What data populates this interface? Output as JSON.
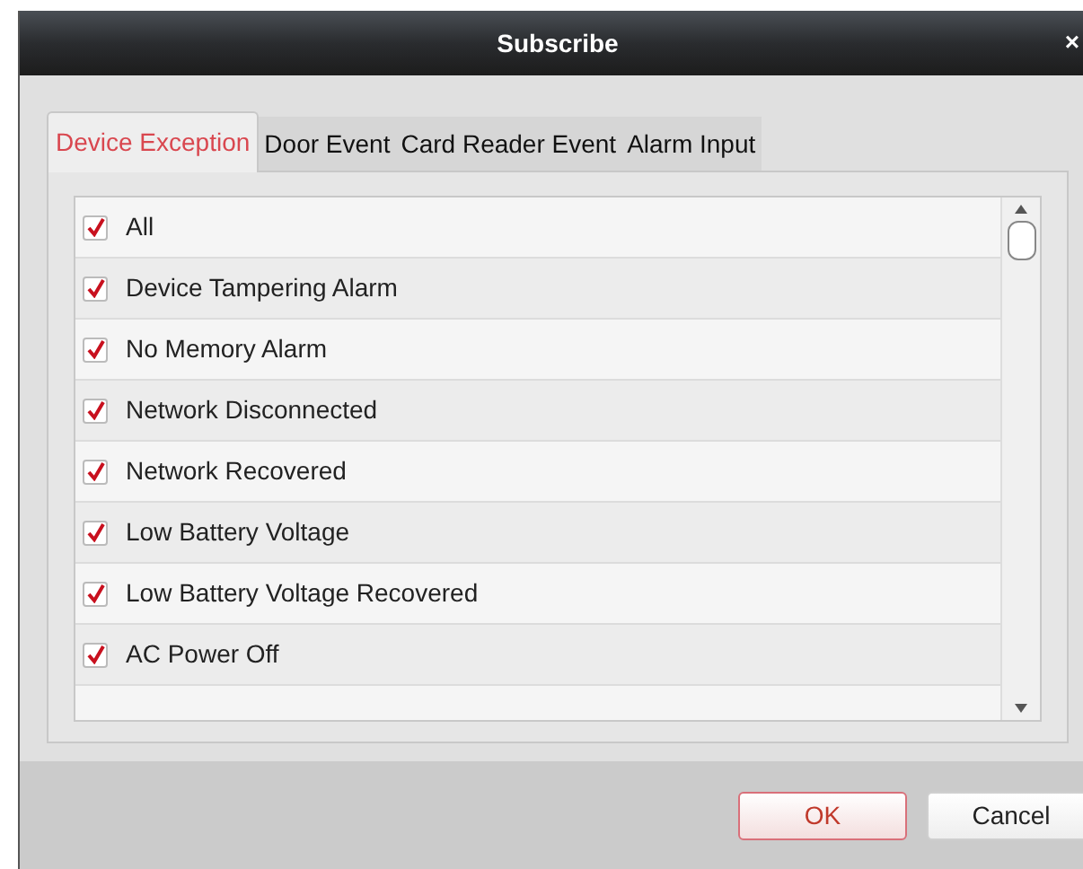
{
  "window": {
    "title": "Subscribe",
    "close": "×"
  },
  "tabs": [
    {
      "label": "Device Exception",
      "selected": true
    },
    {
      "label": "Door Event",
      "selected": false
    },
    {
      "label": "Card Reader Event",
      "selected": false
    },
    {
      "label": "Alarm Input",
      "selected": false
    }
  ],
  "items": [
    {
      "label": "All",
      "checked": true
    },
    {
      "label": "Device Tampering Alarm",
      "checked": true
    },
    {
      "label": "No Memory Alarm",
      "checked": true
    },
    {
      "label": "Network Disconnected",
      "checked": true
    },
    {
      "label": "Network Recovered",
      "checked": true
    },
    {
      "label": "Low Battery Voltage",
      "checked": true
    },
    {
      "label": "Low Battery Voltage Recovered",
      "checked": true
    },
    {
      "label": "AC Power Off",
      "checked": true
    }
  ],
  "buttons": [
    {
      "label": "OK",
      "kind": "primary"
    },
    {
      "label": "Cancel",
      "kind": "secondary"
    }
  ]
}
